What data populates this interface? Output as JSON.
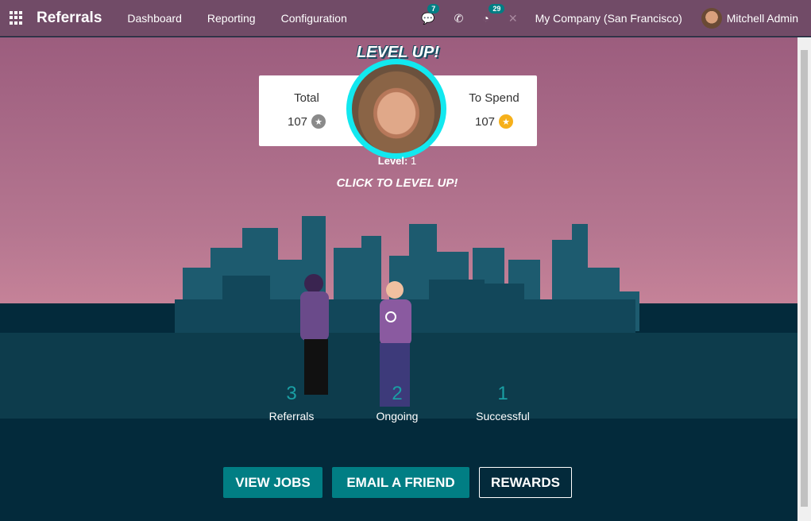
{
  "navbar": {
    "app_name": "Referrals",
    "menus": [
      "Dashboard",
      "Reporting",
      "Configuration"
    ],
    "messages_count": "7",
    "activities_count": "29",
    "company": "My Company (San Francisco)",
    "user": "Mitchell Admin"
  },
  "points": {
    "total_label": "Total",
    "total_value": "107",
    "spend_label": "To Spend",
    "spend_value": "107"
  },
  "level": {
    "banner": "LEVEL UP!",
    "label": "Level:",
    "value": "1",
    "cta": "CLICK TO LEVEL UP!"
  },
  "stats": [
    {
      "value": "3",
      "label": "Referrals"
    },
    {
      "value": "2",
      "label": "Ongoing"
    },
    {
      "value": "1",
      "label": "Successful"
    }
  ],
  "buttons": {
    "view_jobs": "VIEW JOBS",
    "email_friend": "EMAIL A FRIEND",
    "rewards": "REWARDS"
  },
  "colors": {
    "navbar": "#714b67",
    "accent": "#017e84",
    "ring": "#12e8ef",
    "ground": "#032a3b"
  }
}
